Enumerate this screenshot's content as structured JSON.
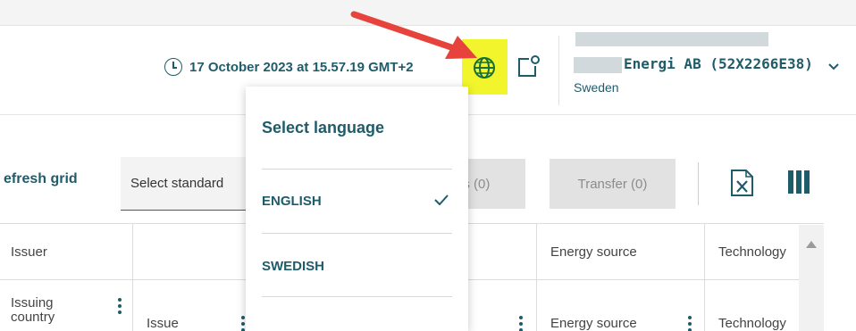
{
  "header": {
    "timestamp": "17 October 2023 at 15.57.19 GMT+2",
    "account": {
      "company": "Energi AB (52X2266E38)",
      "country": "Sweden"
    }
  },
  "icons": {
    "clock": "clock-icon",
    "globe": "globe-icon",
    "share": "share-icon",
    "chevron": "chevron-down-icon",
    "excel": "excel-icon",
    "columns": "columns-icon",
    "check": "check-icon"
  },
  "toolbar": {
    "refresh_label": "efresh grid",
    "select_standard": "Select standard",
    "partial_button": "es (0)",
    "transfer_button": "Transfer (0)"
  },
  "language_menu": {
    "title": "Select language",
    "options": [
      {
        "label": "ENGLISH",
        "selected": true
      },
      {
        "label": "SWEDISH",
        "selected": false
      }
    ]
  },
  "table": {
    "header_row": [
      "Issuer",
      "Energy source",
      "Technology"
    ],
    "filter_row": [
      "Issuing country",
      "Issue",
      "Energy source",
      "Technology"
    ]
  },
  "colors": {
    "accent": "#1f5c6a",
    "highlight": "#f2f52c",
    "arrow": "#e8423c"
  }
}
